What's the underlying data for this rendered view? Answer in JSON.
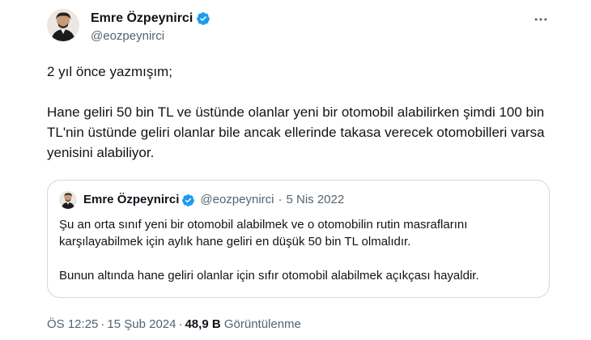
{
  "author": {
    "name": "Emre Özpeynirci",
    "handle": "@eozpeynirci",
    "more_icon": "more-horizontal-icon",
    "verified_icon": "verified-badge-icon",
    "verified_color": "#1d9bf0"
  },
  "tweet": {
    "line1": "2 yıl önce yazmışım;",
    "line2": "Hane geliri 50 bin TL ve üstünde olanlar yeni bir otomobil alabilirken şimdi 100 bin TL'nin üstünde geliri olanlar bile ancak ellerinde takasa verecek otomobilleri varsa yenisini alabiliyor."
  },
  "quote": {
    "name": "Emre Özpeynirci",
    "handle": "@eozpeynirci",
    "separator": "·",
    "date": "5 Nis 2022",
    "paragraph1": "Şu an orta sınıf yeni bir otomobil alabilmek ve o otomobilin rutin masraflarını karşılayabilmek için aylık hane geliri en düşük 50 bin TL olmalıdır.",
    "paragraph2": "Bunun altında hane geliri olanlar için sıfır otomobil alabilmek açıkçası hayaldir."
  },
  "meta": {
    "time": "ÖS 12:25",
    "separator": "·",
    "date": "15 Şub 2024",
    "views_count": "48,9 B",
    "views_label": "Görüntülenme"
  },
  "colors": {
    "text": "#0f1419",
    "secondary": "#536471",
    "border": "#cfd9de"
  }
}
